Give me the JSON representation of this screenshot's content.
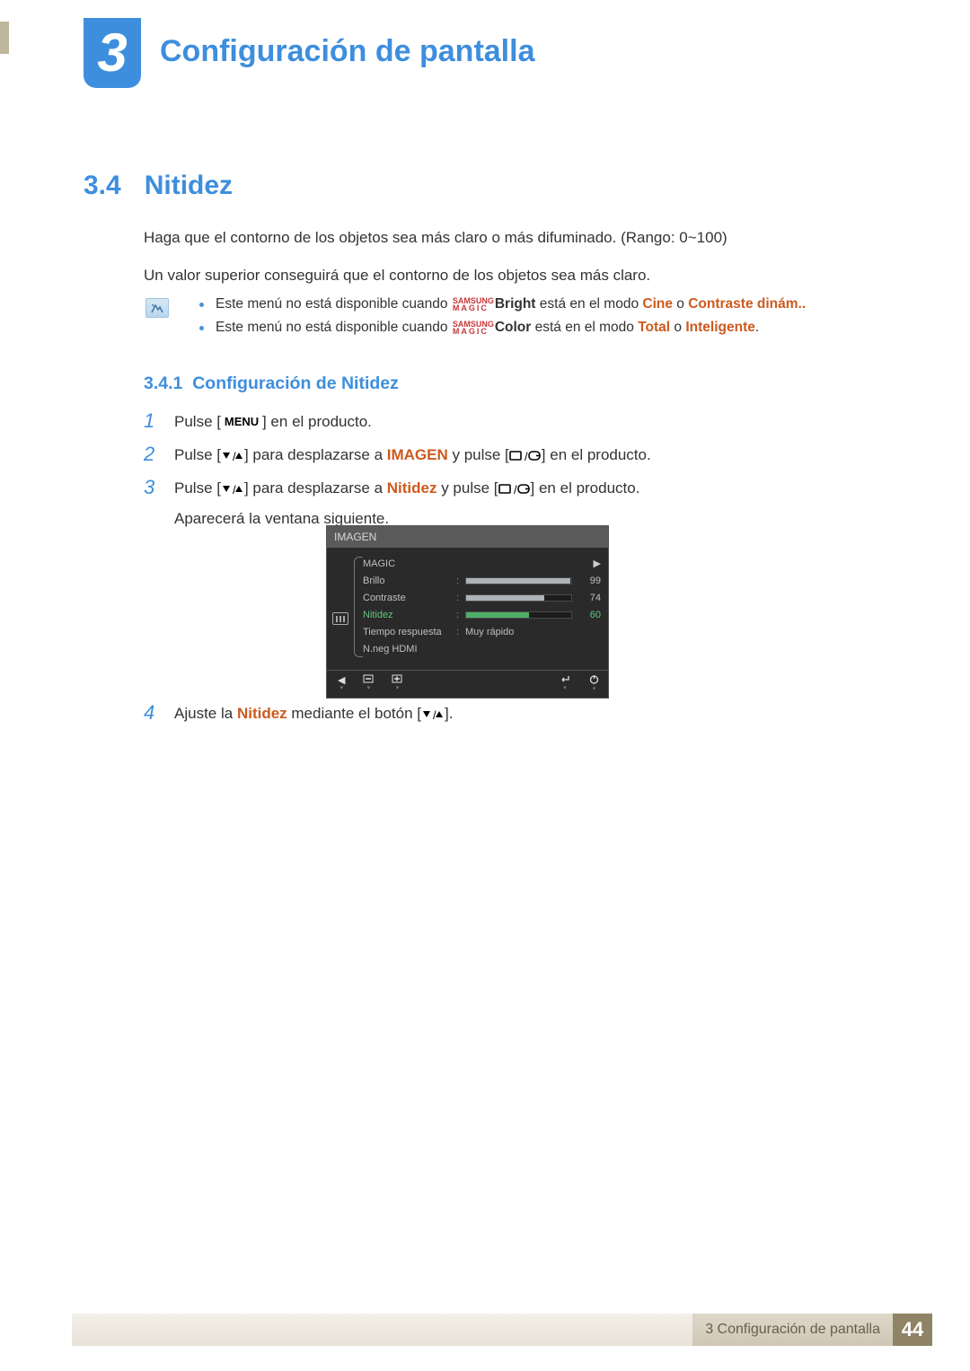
{
  "chapter": {
    "number": "3",
    "title": "Configuración de pantalla"
  },
  "section": {
    "number": "3.4",
    "title": "Nitidez"
  },
  "intro": {
    "p1": "Haga que el contorno de los objetos sea más claro o más difuminado. (Rango: 0~100)",
    "p2": "Un valor superior conseguirá que el contorno de los objetos sea más claro."
  },
  "magic": {
    "top": "SAMSUNG",
    "bot": "MAGIC"
  },
  "notes": {
    "n1": {
      "pre": "Este menú no está disponible cuando ",
      "word": "Bright",
      "mid": " está en el modo ",
      "a": "Cine",
      "or": " o ",
      "b": "Contraste dinám.."
    },
    "n2": {
      "pre": "Este menú no está disponible cuando ",
      "word": "Color",
      "mid": " está en el modo ",
      "a": "Total",
      "or": " o ",
      "b": "Inteligente",
      "end": "."
    }
  },
  "subsection": {
    "number": "3.4.1",
    "title": "Configuración de Nitidez"
  },
  "icons": {
    "menu_label": "MENU"
  },
  "steps": {
    "s1": {
      "n": "1",
      "a": "Pulse [",
      "b": "] en el producto."
    },
    "s2": {
      "n": "2",
      "a": "Pulse [",
      "b": "] para desplazarse a ",
      "kw": "IMAGEN",
      "c": " y pulse [",
      "d": "] en el producto."
    },
    "s3": {
      "n": "3",
      "a": "Pulse [",
      "b": "] para desplazarse a ",
      "kw": "Nitidez",
      "c": " y pulse [",
      "d": "] en el producto.",
      "e": "Aparecerá la ventana siguiente."
    },
    "s4": {
      "n": "4",
      "a": "Ajuste la ",
      "kw": "Nitidez",
      "b": " mediante el botón [",
      "c": "]."
    }
  },
  "osd": {
    "title": "IMAGEN",
    "rows": {
      "magic": {
        "label": "MAGIC",
        "arrow": "▶"
      },
      "brillo": {
        "label": "Brillo",
        "val": "99",
        "pct": 99
      },
      "contraste": {
        "label": "Contraste",
        "val": "74",
        "pct": 74
      },
      "nitidez": {
        "label": "Nitidez",
        "val": "60",
        "pct": 60
      },
      "tiempo": {
        "label": "Tiempo respuesta",
        "val": "Muy rápido"
      },
      "nneg": {
        "label": "N.neg HDMI"
      }
    }
  },
  "footer": {
    "label": "3 Configuración de pantalla",
    "page": "44"
  }
}
